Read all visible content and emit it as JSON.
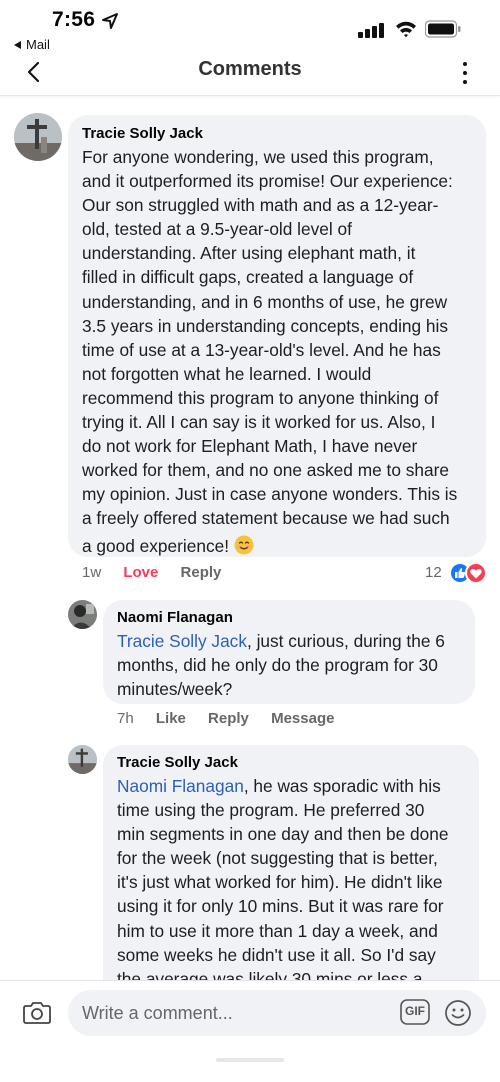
{
  "status_bar": {
    "time": "7:56",
    "back_app": "Mail"
  },
  "header": {
    "title": "Comments"
  },
  "comments": [
    {
      "author": "Tracie Solly Jack",
      "lines": [
        "For anyone wondering, we used this program,",
        "and it outperformed its promise! Our experience:",
        "Our son struggled with math and as a 12-year-",
        "old, tested at a 9.5-year-old level of",
        "understanding. After using elephant math, it",
        "filled in difficult gaps, created a language of",
        "understanding, and in 6 months of use, he grew",
        "3.5 years in understanding concepts, ending his",
        "time of use at a 13-year-old's level. And he has",
        "not forgotten what he learned. I would",
        "recommend this program to anyone thinking of",
        "trying it. All I can say is it worked for us. Also, I",
        "do not work for Elephant Math, I have never",
        "worked for them, and no one asked me to share",
        "my opinion. Just in case anyone wonders. This is",
        "a freely offered statement because we had such",
        "a good experience!"
      ],
      "emoji": "smiling-face-emoji",
      "timestamp": "1w",
      "love_label": "Love",
      "reply_label": "Reply",
      "reaction_count": "12"
    },
    {
      "author": "Naomi Flanagan",
      "mention": "Tracie Solly Jack",
      "line1_rest": ", just curious, during the 6",
      "lines": [
        "months, did he only do the program for 30",
        "minutes/week?"
      ],
      "timestamp": "7h",
      "like_label": "Like",
      "reply_label": "Reply",
      "message_label": "Message"
    },
    {
      "author": "Tracie Solly Jack",
      "mention": "Naomi Flanagan",
      "line1_rest": ", he was sporadic with his",
      "lines": [
        "time using the program. He preferred 30",
        "min segments in one day and then be done",
        "for the week (not suggesting that is better,",
        "it's just what worked for him). He didn't like",
        "using it for only 10 mins. But it was rare for",
        "him to use it more than 1 day a week, and",
        "some weeks he didn't use it all.  So I'd say",
        "the average was likely 30 mins or less a"
      ]
    }
  ],
  "composer": {
    "placeholder": "Write a comment...",
    "gif_label": "GIF"
  },
  "colors": {
    "bubble": "#f0f2f5",
    "mention": "#2d5fb8",
    "love": "#f33e58",
    "like_badge": "#1877f2",
    "meta": "#65676b"
  }
}
